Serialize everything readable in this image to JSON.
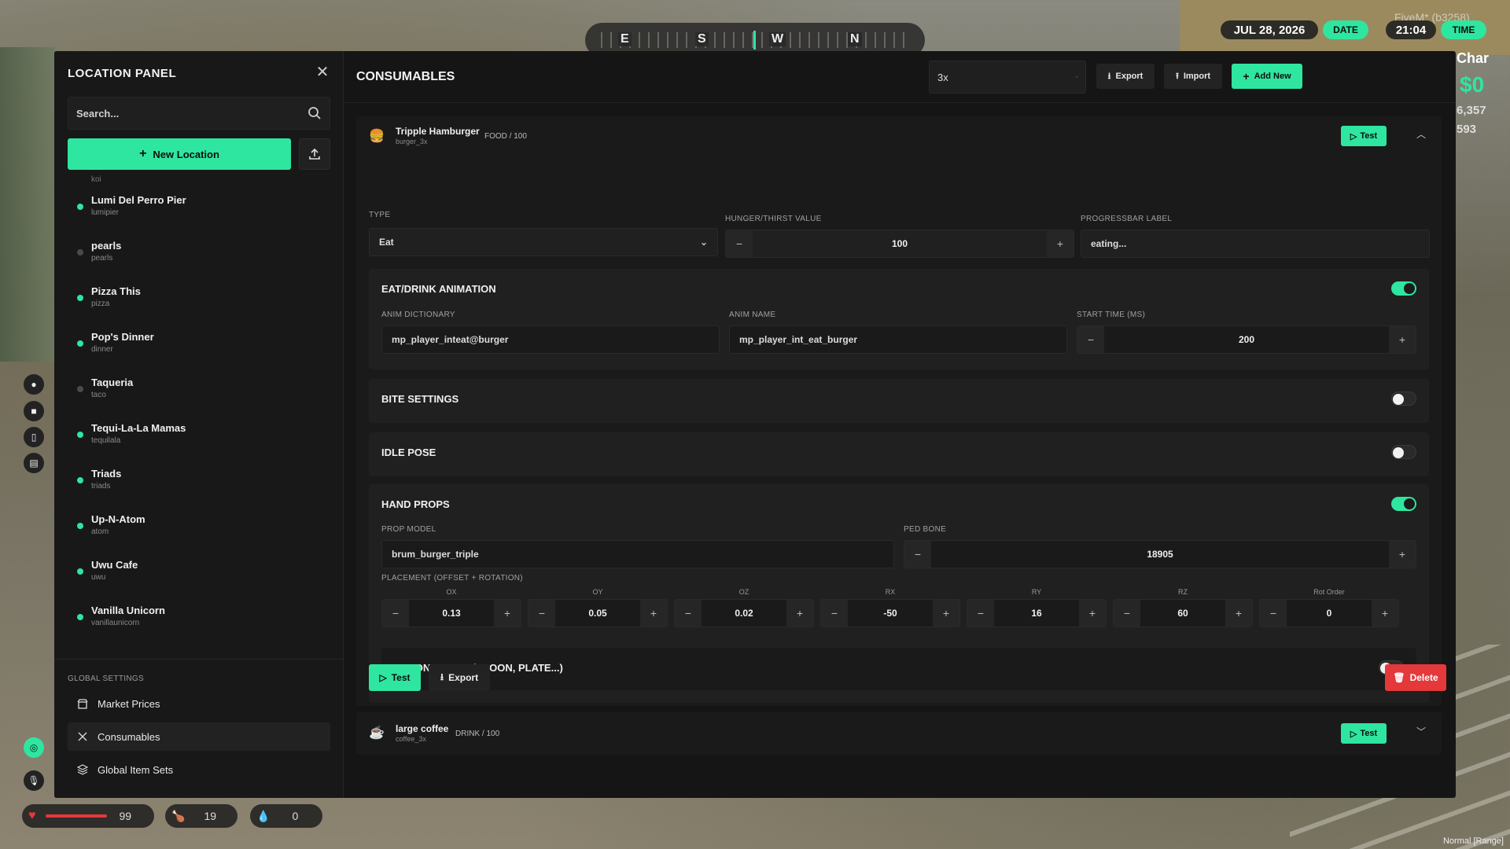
{
  "hud": {
    "compass": {
      "e": "E",
      "s": "S",
      "w": "W",
      "n": "N"
    },
    "date_value": "JUL 28, 2026",
    "date_label": "DATE",
    "time_value": "21:04",
    "time_label": "TIME",
    "server": "FiveM* (b3258)",
    "char_label": "Char",
    "money": "$0",
    "side_val1": "6,357",
    "side_val2": "593",
    "health": "99",
    "hunger": "19",
    "thirst": "0",
    "status_bottom": "Normal [Range]",
    "accent": "#2ee6a0"
  },
  "sidebar": {
    "title": "LOCATION PANEL",
    "search_placeholder": "Search...",
    "new_location_label": "New Location",
    "cut_item": "koi",
    "locations": [
      {
        "name": "Lumi Del Perro Pier",
        "id": "lumipier",
        "active": true
      },
      {
        "name": "pearls",
        "id": "pearls",
        "active": false
      },
      {
        "name": "Pizza This",
        "id": "pizza",
        "active": true
      },
      {
        "name": "Pop's Dinner",
        "id": "dinner",
        "active": true
      },
      {
        "name": "Taqueria",
        "id": "taco",
        "active": false
      },
      {
        "name": "Tequi-La-La Mamas",
        "id": "tequilala",
        "active": true
      },
      {
        "name": "Triads",
        "id": "triads",
        "active": true
      },
      {
        "name": "Up-N-Atom",
        "id": "atom",
        "active": true
      },
      {
        "name": "Uwu Cafe",
        "id": "uwu",
        "active": true
      },
      {
        "name": "Vanilla Unicorn",
        "id": "vanillaunicorn",
        "active": true
      }
    ],
    "global_settings_title": "GLOBAL SETTINGS",
    "global_items": [
      {
        "label": "Market Prices",
        "icon": "store-icon"
      },
      {
        "label": "Consumables",
        "icon": "utensils-icon",
        "active": true
      },
      {
        "label": "Global Item Sets",
        "icon": "layers-icon"
      }
    ]
  },
  "main": {
    "title": "CONSUMABLES",
    "search_value": "3x",
    "export_label": "Export",
    "import_label": "Import",
    "add_new_label": "Add New",
    "items": [
      {
        "name": "Tripple Hamburger",
        "id": "burger_3x",
        "category": "FOOD / 100",
        "test_label": "Test",
        "type_label": "TYPE",
        "type_value": "Eat",
        "hunger_label": "HUNGER/THIRST VALUE",
        "hunger_value": "100",
        "progress_label": "PROGRESSBAR LABEL",
        "progress_value": "eating...",
        "anim": {
          "title": "EAT/DRINK ANIMATION",
          "enabled": true,
          "dict_label": "ANIM DICTIONARY",
          "dict_value": "mp_player_inteat@burger",
          "name_label": "ANIM NAME",
          "name_value": "mp_player_int_eat_burger",
          "start_label": "START TIME (MS)",
          "start_value": "200"
        },
        "bite": {
          "title": "BITE SETTINGS",
          "enabled": false
        },
        "idle": {
          "title": "IDLE POSE",
          "enabled": false
        },
        "hand_props": {
          "title": "HAND PROPS",
          "enabled": true,
          "model_label": "PROP MODEL",
          "model_value": "brum_burger_triple",
          "bone_label": "PED BONE",
          "bone_value": "18905",
          "placement_label": "PLACEMENT (OFFSET + ROTATION)",
          "placement": [
            {
              "axis": "OX",
              "value": "0.13"
            },
            {
              "axis": "OY",
              "value": "0.05"
            },
            {
              "axis": "OZ",
              "value": "0.02"
            },
            {
              "axis": "RX",
              "value": "-50"
            },
            {
              "axis": "RY",
              "value": "16"
            },
            {
              "axis": "RZ",
              "value": "60"
            },
            {
              "axis": "Rot Order",
              "value": "0"
            }
          ],
          "second_prop": {
            "title": "SECOND PROP (SPOON, PLATE...)",
            "enabled": false
          }
        },
        "footer": {
          "test": "Test",
          "export": "Export",
          "delete": "Delete"
        }
      },
      {
        "name": "large coffee",
        "id": "coffee_3x",
        "category": "DRINK / 100",
        "test_label": "Test"
      }
    ]
  }
}
